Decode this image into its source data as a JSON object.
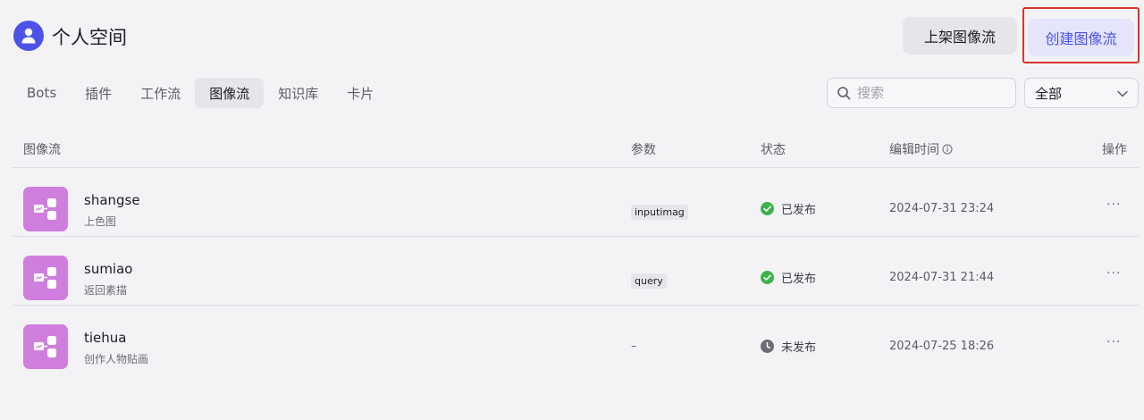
{
  "header": {
    "title": "个人空间",
    "publish_button": "上架图像流",
    "create_button": "创建图像流"
  },
  "tabs": [
    {
      "label": "Bots",
      "active": false
    },
    {
      "label": "插件",
      "active": false
    },
    {
      "label": "工作流",
      "active": false
    },
    {
      "label": "图像流",
      "active": true
    },
    {
      "label": "知识库",
      "active": false
    },
    {
      "label": "卡片",
      "active": false
    }
  ],
  "search": {
    "placeholder": "搜索",
    "value": ""
  },
  "filter": {
    "selected": "全部"
  },
  "table": {
    "columns": {
      "name": "图像流",
      "params": "参数",
      "status": "状态",
      "edit_time": "编辑时间",
      "actions": "操作"
    },
    "rows": [
      {
        "name": "shangse",
        "desc": "上色图",
        "param": "inputimag",
        "status": "已发布",
        "status_kind": "published",
        "time": "2024-07-31 23:24",
        "more": "···"
      },
      {
        "name": "sumiao",
        "desc": "返回素描",
        "param": "query",
        "status": "已发布",
        "status_kind": "published",
        "time": "2024-07-31 21:44",
        "more": "···"
      },
      {
        "name": "tiehua",
        "desc": "创作人物贴画",
        "param": "–",
        "status": "未发布",
        "status_kind": "unpublished",
        "time": "2024-07-25 18:26",
        "more": "···"
      }
    ]
  },
  "colors": {
    "accent": "#4d53e8",
    "icon_bg": "#d07ede",
    "published": "#3eb24a",
    "unpublished": "#6b6c76",
    "highlight_border": "#d8332a"
  }
}
